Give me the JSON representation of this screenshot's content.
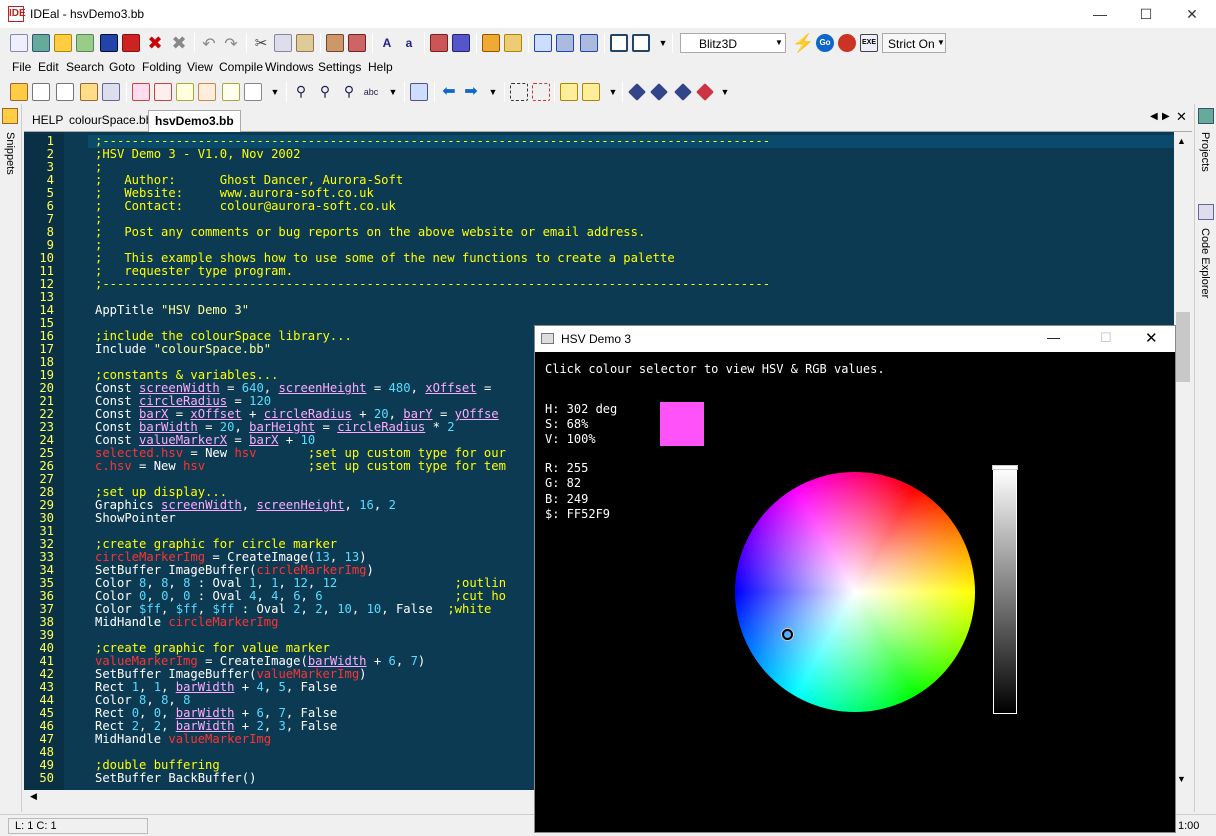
{
  "window": {
    "title": "IDEal - hsvDemo3.bb",
    "app_icon": "IDE"
  },
  "menu": [
    "File",
    "Edit",
    "Search",
    "Goto",
    "Folding",
    "View",
    "Compile",
    "Windows",
    "Settings",
    "Help"
  ],
  "toolbar": {
    "target": "Blitz3D",
    "strict": "Strict On"
  },
  "tabs": {
    "help": "HELP",
    "file1": "colourSpace.bb",
    "file2": "hsvDemo3.bb"
  },
  "docks": {
    "left": "Snippets",
    "right1": "Projects",
    "right2": "Code Explorer"
  },
  "status": {
    "pos": "L: 1 C: 1",
    "time": "1:00"
  },
  "code": [
    [
      [
        "cm",
        ";-------------------------------------------------------------------------------------------"
      ]
    ],
    [
      [
        "cm",
        ";HSV Demo 3 - V1.0, Nov 2002"
      ]
    ],
    [
      [
        "cm",
        ";"
      ]
    ],
    [
      [
        "cm",
        ";   Author:      Ghost Dancer, Aurora-Soft"
      ]
    ],
    [
      [
        "cm",
        ";   Website:     www.aurora-soft.co.uk"
      ]
    ],
    [
      [
        "cm",
        ";   Contact:     colour@aurora-soft.co.uk"
      ]
    ],
    [
      [
        "cm",
        ";"
      ]
    ],
    [
      [
        "cm",
        ";   Post any comments or bug reports on the above website or email address."
      ]
    ],
    [
      [
        "cm",
        ";"
      ]
    ],
    [
      [
        "cm",
        ";   This example shows how to use some of the new functions to create a palette"
      ]
    ],
    [
      [
        "cm",
        ";   requester type program."
      ]
    ],
    [
      [
        "cm",
        ";-------------------------------------------------------------------------------------------"
      ]
    ],
    [],
    [
      [
        "kw",
        "AppTitle "
      ],
      [
        "st",
        "\"HSV Demo 3\""
      ]
    ],
    [],
    [
      [
        "cm",
        ";include the colourSpace library..."
      ]
    ],
    [
      [
        "kw",
        "Include "
      ],
      [
        "st",
        "\"colourSpace.bb\""
      ]
    ],
    [],
    [
      [
        "cm",
        ";constants & variables..."
      ]
    ],
    [
      [
        "kw",
        "Const "
      ],
      [
        "vr",
        "screenWidth"
      ],
      [
        "df",
        " = "
      ],
      [
        "nm",
        "640"
      ],
      [
        "df",
        ", "
      ],
      [
        "vr",
        "screenHeight"
      ],
      [
        "df",
        " = "
      ],
      [
        "nm",
        "480"
      ],
      [
        "df",
        ", "
      ],
      [
        "vr",
        "xOffset"
      ],
      [
        "df",
        " = "
      ]
    ],
    [
      [
        "kw",
        "Const "
      ],
      [
        "vr",
        "circleRadius"
      ],
      [
        "df",
        " = "
      ],
      [
        "nm",
        "120"
      ]
    ],
    [
      [
        "kw",
        "Const "
      ],
      [
        "vr",
        "barX"
      ],
      [
        "df",
        " = "
      ],
      [
        "vr",
        "xOffset"
      ],
      [
        "df",
        " + "
      ],
      [
        "vr",
        "circleRadius"
      ],
      [
        "df",
        " + "
      ],
      [
        "nm",
        "20"
      ],
      [
        "df",
        ", "
      ],
      [
        "vr",
        "barY"
      ],
      [
        "df",
        " = "
      ],
      [
        "vr",
        "yOffse"
      ]
    ],
    [
      [
        "kw",
        "Const "
      ],
      [
        "vr",
        "barWidth"
      ],
      [
        "df",
        " = "
      ],
      [
        "nm",
        "20"
      ],
      [
        "df",
        ", "
      ],
      [
        "vr",
        "barHeight"
      ],
      [
        "df",
        " = "
      ],
      [
        "vr",
        "circleRadius"
      ],
      [
        "df",
        " * "
      ],
      [
        "nm",
        "2"
      ]
    ],
    [
      [
        "kw",
        "Const "
      ],
      [
        "vr",
        "valueMarkerX"
      ],
      [
        "df",
        " = "
      ],
      [
        "vr",
        "barX"
      ],
      [
        "df",
        " + "
      ],
      [
        "nm",
        "10"
      ]
    ],
    [
      [
        "rd",
        "selected.hsv"
      ],
      [
        "df",
        " = "
      ],
      [
        "kw",
        "New "
      ],
      [
        "rd",
        "hsv"
      ],
      [
        "df",
        "       "
      ],
      [
        "cm",
        ";set up custom type for our"
      ]
    ],
    [
      [
        "rd",
        "c.hsv"
      ],
      [
        "df",
        " = "
      ],
      [
        "kw",
        "New "
      ],
      [
        "rd",
        "hsv"
      ],
      [
        "df",
        "              "
      ],
      [
        "cm",
        ";set up custom type for tem"
      ]
    ],
    [],
    [
      [
        "cm",
        ";set up display..."
      ]
    ],
    [
      [
        "kw",
        "Graphics "
      ],
      [
        "vr",
        "screenWidth"
      ],
      [
        "df",
        ", "
      ],
      [
        "vr",
        "screenHeight"
      ],
      [
        "df",
        ", "
      ],
      [
        "nm",
        "16"
      ],
      [
        "df",
        ", "
      ],
      [
        "nm",
        "2"
      ]
    ],
    [
      [
        "kw",
        "ShowPointer"
      ]
    ],
    [],
    [
      [
        "cm",
        ";create graphic for circle marker"
      ]
    ],
    [
      [
        "rd",
        "circleMarkerImg"
      ],
      [
        "df",
        " = "
      ],
      [
        "kw",
        "CreateImage("
      ],
      [
        "nm",
        "13"
      ],
      [
        "df",
        ", "
      ],
      [
        "nm",
        "13"
      ],
      [
        "df",
        ")"
      ]
    ],
    [
      [
        "kw",
        "SetBuffer ImageBuffer("
      ],
      [
        "rd",
        "circleMarkerImg"
      ],
      [
        "df",
        ")"
      ]
    ],
    [
      [
        "kw",
        "Color "
      ],
      [
        "nm",
        "8"
      ],
      [
        "df",
        ", "
      ],
      [
        "nm",
        "8"
      ],
      [
        "df",
        ", "
      ],
      [
        "nm",
        "8"
      ],
      [
        "df",
        " : "
      ],
      [
        "kw",
        "Oval "
      ],
      [
        "nm",
        "1"
      ],
      [
        "df",
        ", "
      ],
      [
        "nm",
        "1"
      ],
      [
        "df",
        ", "
      ],
      [
        "nm",
        "12"
      ],
      [
        "df",
        ", "
      ],
      [
        "nm",
        "12"
      ],
      [
        "df",
        "                "
      ],
      [
        "cm",
        ";outlin"
      ]
    ],
    [
      [
        "kw",
        "Color "
      ],
      [
        "nm",
        "0"
      ],
      [
        "df",
        ", "
      ],
      [
        "nm",
        "0"
      ],
      [
        "df",
        ", "
      ],
      [
        "nm",
        "0"
      ],
      [
        "df",
        " : "
      ],
      [
        "kw",
        "Oval "
      ],
      [
        "nm",
        "4"
      ],
      [
        "df",
        ", "
      ],
      [
        "nm",
        "4"
      ],
      [
        "df",
        ", "
      ],
      [
        "nm",
        "6"
      ],
      [
        "df",
        ", "
      ],
      [
        "nm",
        "6"
      ],
      [
        "df",
        "                  "
      ],
      [
        "cm",
        ";cut ho"
      ]
    ],
    [
      [
        "kw",
        "Color "
      ],
      [
        "nm",
        "$ff"
      ],
      [
        "df",
        ", "
      ],
      [
        "nm",
        "$ff"
      ],
      [
        "df",
        ", "
      ],
      [
        "nm",
        "$ff"
      ],
      [
        "df",
        " : "
      ],
      [
        "kw",
        "Oval "
      ],
      [
        "nm",
        "2"
      ],
      [
        "df",
        ", "
      ],
      [
        "nm",
        "2"
      ],
      [
        "df",
        ", "
      ],
      [
        "nm",
        "10"
      ],
      [
        "df",
        ", "
      ],
      [
        "nm",
        "10"
      ],
      [
        "df",
        ", "
      ],
      [
        "kw",
        "False"
      ],
      [
        "df",
        "  "
      ],
      [
        "cm",
        ";white"
      ]
    ],
    [
      [
        "kw",
        "MidHandle "
      ],
      [
        "rd",
        "circleMarkerImg"
      ]
    ],
    [],
    [
      [
        "cm",
        ";create graphic for value marker"
      ]
    ],
    [
      [
        "rd",
        "valueMarkerImg"
      ],
      [
        "df",
        " = "
      ],
      [
        "kw",
        "CreateImage("
      ],
      [
        "vr",
        "barWidth"
      ],
      [
        "df",
        " + "
      ],
      [
        "nm",
        "6"
      ],
      [
        "df",
        ", "
      ],
      [
        "nm",
        "7"
      ],
      [
        "df",
        ")"
      ]
    ],
    [
      [
        "kw",
        "SetBuffer ImageBuffer("
      ],
      [
        "rd",
        "valueMarkerImg"
      ],
      [
        "df",
        ")"
      ]
    ],
    [
      [
        "kw",
        "Rect "
      ],
      [
        "nm",
        "1"
      ],
      [
        "df",
        ", "
      ],
      [
        "nm",
        "1"
      ],
      [
        "df",
        ", "
      ],
      [
        "vr",
        "barWidth"
      ],
      [
        "df",
        " + "
      ],
      [
        "nm",
        "4"
      ],
      [
        "df",
        ", "
      ],
      [
        "nm",
        "5"
      ],
      [
        "df",
        ", "
      ],
      [
        "kw",
        "False"
      ]
    ],
    [
      [
        "kw",
        "Color "
      ],
      [
        "nm",
        "8"
      ],
      [
        "df",
        ", "
      ],
      [
        "nm",
        "8"
      ],
      [
        "df",
        ", "
      ],
      [
        "nm",
        "8"
      ]
    ],
    [
      [
        "kw",
        "Rect "
      ],
      [
        "nm",
        "0"
      ],
      [
        "df",
        ", "
      ],
      [
        "nm",
        "0"
      ],
      [
        "df",
        ", "
      ],
      [
        "vr",
        "barWidth"
      ],
      [
        "df",
        " + "
      ],
      [
        "nm",
        "6"
      ],
      [
        "df",
        ", "
      ],
      [
        "nm",
        "7"
      ],
      [
        "df",
        ", "
      ],
      [
        "kw",
        "False"
      ]
    ],
    [
      [
        "kw",
        "Rect "
      ],
      [
        "nm",
        "2"
      ],
      [
        "df",
        ", "
      ],
      [
        "nm",
        "2"
      ],
      [
        "df",
        ", "
      ],
      [
        "vr",
        "barWidth"
      ],
      [
        "df",
        " + "
      ],
      [
        "nm",
        "2"
      ],
      [
        "df",
        ", "
      ],
      [
        "nm",
        "3"
      ],
      [
        "df",
        ", "
      ],
      [
        "kw",
        "False"
      ]
    ],
    [
      [
        "kw",
        "MidHandle "
      ],
      [
        "rd",
        "valueMarkerImg"
      ]
    ],
    [],
    [
      [
        "cm",
        ";double buffering"
      ]
    ],
    [
      [
        "kw",
        "SetBuffer BackBuffer()"
      ]
    ]
  ],
  "hsv_window": {
    "title": "HSV Demo 3",
    "prompt": "Click colour selector to view HSV & RGB values.",
    "h": "H: 302 deg",
    "s": "S: 68%",
    "v": "V: 100%",
    "r": "R: 255",
    "g": "G: 82",
    "b": "B: 249",
    "hex": "$: FF52F9",
    "swatch_color": "#ff52f9"
  }
}
